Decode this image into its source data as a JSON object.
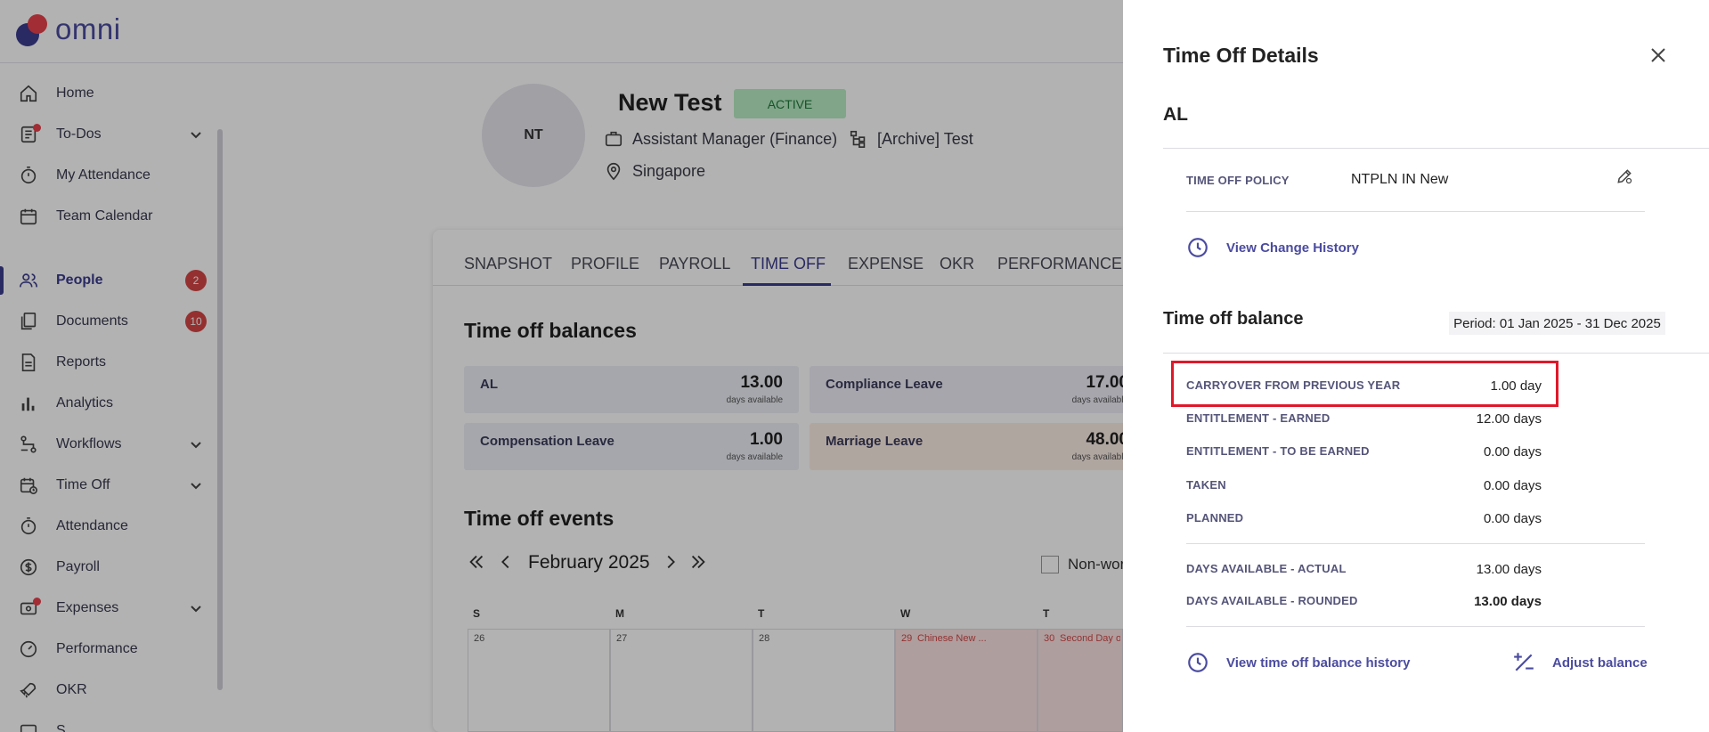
{
  "app": {
    "logo_text": "omni"
  },
  "sidebar": {
    "items": [
      {
        "label": "Home",
        "icon": "home-icon"
      },
      {
        "label": "To-Dos",
        "icon": "todo-list-icon"
      },
      {
        "label": "My Attendance",
        "icon": "stopwatch-icon"
      },
      {
        "label": "Team Calendar",
        "icon": "calendar-icon"
      },
      {
        "label": "People",
        "icon": "people-icon",
        "badge": "2",
        "active": true
      },
      {
        "label": "Documents",
        "icon": "documents-icon",
        "badge": "10"
      },
      {
        "label": "Reports",
        "icon": "report-icon"
      },
      {
        "label": "Analytics",
        "icon": "bar-chart-icon"
      },
      {
        "label": "Workflows",
        "icon": "workflow-icon"
      },
      {
        "label": "Time Off",
        "icon": "time-off-calendar-icon"
      },
      {
        "label": "Attendance",
        "icon": "stopwatch-icon"
      },
      {
        "label": "Payroll",
        "icon": "dollar-icon"
      },
      {
        "label": "Expenses",
        "icon": "expenses-icon"
      },
      {
        "label": "Performance",
        "icon": "gauge-icon"
      },
      {
        "label": "OKR",
        "icon": "rocket-icon"
      },
      {
        "label": "S...",
        "icon": "generic-icon"
      }
    ]
  },
  "employee": {
    "initials": "NT",
    "name": "New Test",
    "status": "ACTIVE",
    "job_title": "Assistant Manager (Finance)",
    "department": "[Archive] Test",
    "location": "Singapore"
  },
  "tabs": [
    "SNAPSHOT",
    "PROFILE",
    "PAYROLL",
    "TIME OFF",
    "EXPENSE",
    "OKR",
    "PERFORMANCE"
  ],
  "active_tab": "TIME OFF",
  "balances_section": {
    "title": "Time off balances",
    "items": [
      {
        "name": "AL",
        "value": "13.00",
        "unit": "days available"
      },
      {
        "name": "Compliance Leave",
        "value": "17.00",
        "unit": "days available"
      },
      {
        "name": "Compensation Leave",
        "value": "1.00",
        "unit": "days available"
      },
      {
        "name": "Marriage Leave",
        "value": "48.00",
        "unit": "days available"
      }
    ]
  },
  "events_section": {
    "title": "Time off events",
    "month": "February 2025",
    "non_working_label": "Non-wor",
    "weekday_headers": [
      "S",
      "M",
      "T",
      "W",
      "T"
    ],
    "cells": [
      {
        "day": "26",
        "event": ""
      },
      {
        "day": "27",
        "event": ""
      },
      {
        "day": "28",
        "event": ""
      },
      {
        "day": "29",
        "event": "Chinese New ..."
      },
      {
        "day": "30",
        "event": "Second Day o..."
      }
    ]
  },
  "drawer": {
    "title": "Time Off Details",
    "leave_type": "AL",
    "policy_label": "TIME OFF POLICY",
    "policy_value": "NTPLN IN New",
    "view_change_history": "View Change History",
    "balance_title": "Time off balance",
    "period": "Period: 01 Jan 2025 - 31 Dec 2025",
    "rows": [
      {
        "label": "CARRYOVER FROM PREVIOUS YEAR",
        "value": "1.00 day"
      },
      {
        "label": "ENTITLEMENT - EARNED",
        "value": "12.00 days"
      },
      {
        "label": "ENTITLEMENT - TO BE EARNED",
        "value": "0.00 days"
      },
      {
        "label": "TAKEN",
        "value": "0.00 days"
      },
      {
        "label": "PLANNED",
        "value": "0.00 days"
      }
    ],
    "available_rows": [
      {
        "label": "DAYS AVAILABLE - ACTUAL",
        "value": "13.00 days"
      },
      {
        "label": "DAYS AVAILABLE - ROUNDED",
        "value": "13.00 days"
      }
    ],
    "view_balance_history": "View time off balance history",
    "adjust_balance": "Adjust balance"
  },
  "colors": {
    "accent": "#3b3b8f",
    "brand_red": "#e8414b",
    "highlight_box": "#e0182a"
  }
}
